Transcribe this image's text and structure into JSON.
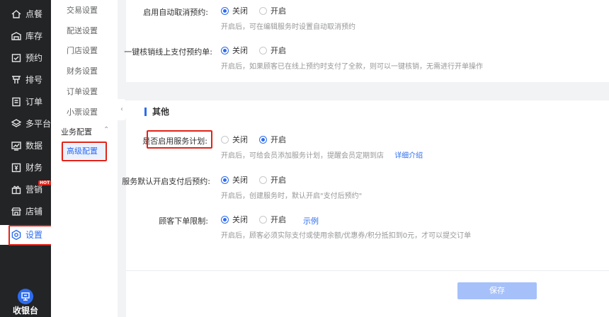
{
  "leftnav": {
    "items": [
      {
        "label": "点餐",
        "icon": "home-icon"
      },
      {
        "label": "库存",
        "icon": "inventory-icon"
      },
      {
        "label": "预约",
        "icon": "appointment-icon"
      },
      {
        "label": "排号",
        "icon": "queue-icon"
      },
      {
        "label": "订单",
        "icon": "order-icon"
      },
      {
        "label": "多平台",
        "icon": "layers-icon"
      },
      {
        "label": "数据",
        "icon": "data-icon"
      },
      {
        "label": "财务",
        "icon": "finance-icon"
      },
      {
        "label": "营销",
        "icon": "marketing-icon",
        "badge": "HOT"
      },
      {
        "label": "店铺",
        "icon": "store-icon"
      },
      {
        "label": "设置",
        "icon": "settings-icon"
      }
    ],
    "cashier_label": "收银台"
  },
  "subnav": {
    "items": [
      "交易设置",
      "配送设置",
      "门店设置",
      "财务设置",
      "订单设置",
      "小票设置"
    ],
    "group_label": "业务配置",
    "active_label": "高级配置"
  },
  "settings": {
    "auto_cancel": {
      "label": "启用自动取消预约:",
      "off": "关闭",
      "on": "开启",
      "help": "开启后，可在编辑服务时设置自动取消预约"
    },
    "one_click": {
      "label": "一键核销线上支付预约单:",
      "off": "关闭",
      "on": "开启",
      "help": "开启后，如果顾客已在线上预约时支付了全款，则可以一键核销，无需进行开单操作"
    },
    "section_other": "其他",
    "service_plan": {
      "label": "是否启用服务计划:",
      "off": "关闭",
      "on": "开启",
      "help": "开启后，可给会员添加服务计划，提醒会员定期到店",
      "link": "详细介绍"
    },
    "default_pay_after": {
      "label": "服务默认开启支付后预约:",
      "off": "关闭",
      "on": "开启",
      "help": "开启后，创建服务时，默认开启\"支付后预约\""
    },
    "order_limit": {
      "label": "顾客下单限制:",
      "off": "关闭",
      "on": "开启",
      "example": "示例",
      "help": "开启后，顾客必须实际支付或使用余额/优惠券/积分抵扣到0元，才可以提交订单"
    }
  },
  "footer": {
    "save_label": "保存"
  },
  "colors": {
    "accent": "#2d6cf0",
    "nav_bg": "#232426",
    "highlight_border": "#e2231a"
  }
}
